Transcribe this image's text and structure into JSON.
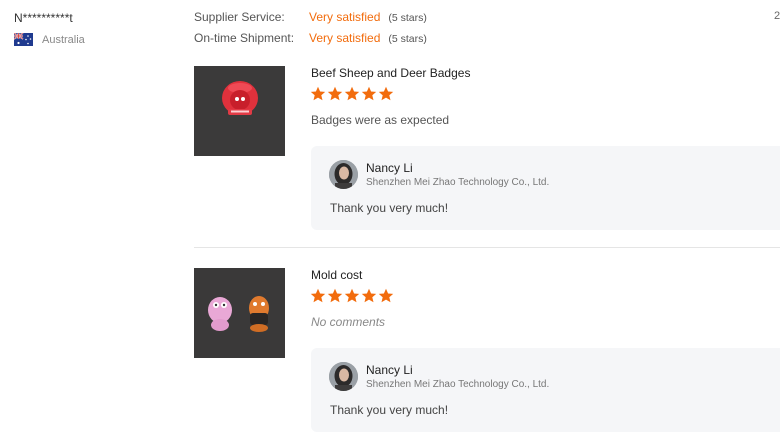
{
  "reviewer": {
    "name": "N**********t",
    "country": "Australia"
  },
  "top_right_number": "2",
  "ratings": [
    {
      "label": "Supplier Service:",
      "value": "Very satisfied",
      "stars": "(5 stars)"
    },
    {
      "label": "On-time Shipment:",
      "value": "Very satisfied",
      "stars": "(5 stars)"
    }
  ],
  "reviews": [
    {
      "product": "Beef Sheep and Deer Badges",
      "rating": 5,
      "comment": "Badges were as expected",
      "reply": {
        "name": "Nancy Li",
        "company": "Shenzhen Mei Zhao Technology Co., Ltd.",
        "text": "Thank you very much!"
      }
    },
    {
      "product": "Mold cost",
      "rating": 5,
      "comment": "No comments",
      "reply": {
        "name": "Nancy Li",
        "company": "Shenzhen Mei Zhao Technology Co., Ltd.",
        "text": "Thank you very much!"
      }
    }
  ],
  "colors": {
    "accent": "#f26c0d",
    "reply_bg": "#f5f6f8"
  }
}
